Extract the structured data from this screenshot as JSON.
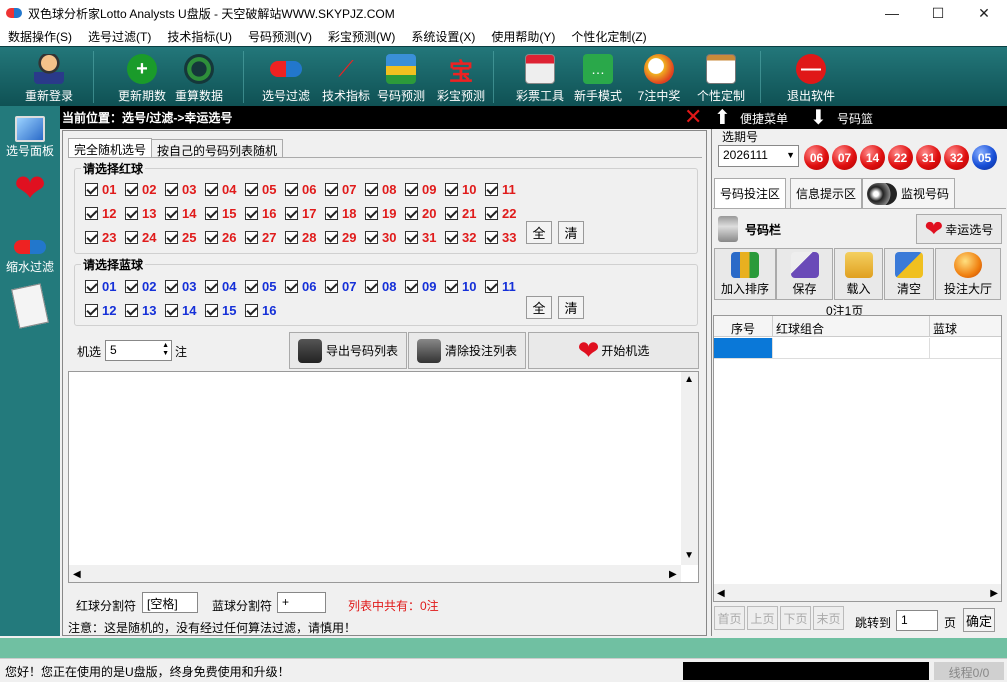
{
  "window": {
    "title": "双色球分析家Lotto Analysts U盘版 - 天空破解站WWW.SKYPJZ.COM",
    "min": "—",
    "max": "☐",
    "close": "✕"
  },
  "menu": [
    "数据操作(S)",
    "选号过滤(T)",
    "技术指标(U)",
    "号码预测(V)",
    "彩宝预测(W)",
    "系统设置(X)",
    "使用帮助(Y)",
    "个性化定制(Z)"
  ],
  "toolbar": {
    "relogin": "重新登录",
    "update": "更新期数",
    "recalc": "重算数据",
    "filter": "选号过滤",
    "tech": "技术指标",
    "predict": "号码预测",
    "cbpredict": "彩宝预测",
    "tools": "彩票工具",
    "novice": "新手模式",
    "win": "7注中奖",
    "custom": "个性定制",
    "exit": "退出软件"
  },
  "left_panel": {
    "select_panel": "选号面板",
    "shrink_filter": "缩水过滤"
  },
  "breadcrumb": {
    "text": "当前位置：选号/过滤->幸运选号",
    "quick_menu": "便捷菜单",
    "basket": "号码篮"
  },
  "tabs": {
    "random_all": "完全随机选号",
    "random_own": "按自己的号码列表随机"
  },
  "red_section": {
    "label": "请选择红球",
    "numbers": [
      "01",
      "02",
      "03",
      "04",
      "05",
      "06",
      "07",
      "08",
      "09",
      "10",
      "11",
      "12",
      "13",
      "14",
      "15",
      "16",
      "17",
      "18",
      "19",
      "20",
      "21",
      "22",
      "23",
      "24",
      "25",
      "26",
      "27",
      "28",
      "29",
      "30",
      "31",
      "32",
      "33"
    ],
    "all": "全",
    "clear": "清"
  },
  "blue_section": {
    "label": "请选择蓝球",
    "numbers": [
      "01",
      "02",
      "03",
      "04",
      "05",
      "06",
      "07",
      "08",
      "09",
      "10",
      "11",
      "12",
      "13",
      "14",
      "15",
      "16"
    ],
    "all": "全",
    "clear": "清"
  },
  "machine": {
    "label": "机选",
    "value": "5",
    "unit": "注",
    "export": "导出号码列表",
    "clear_list": "清除投注列表",
    "start": "开始机选"
  },
  "separators": {
    "red_label": "红球分割符",
    "red_value": "[空格]",
    "blue_label": "蓝球分割符",
    "blue_value": "+",
    "count_text": "列表中共有：0注"
  },
  "notice": "注意：这是随机的，没有经过任何算法过滤，请慎用！",
  "right": {
    "period_label": "选期号",
    "period_value": "2026111",
    "red_balls": [
      "06",
      "07",
      "14",
      "22",
      "31",
      "32"
    ],
    "blue_ball": "05",
    "tabs": [
      "号码投注区",
      "信息提示区",
      "监视号码"
    ],
    "basket_label": "号码栏",
    "lucky_button": "幸运选号",
    "tools": [
      "加入排序",
      "保存",
      "载入",
      "清空",
      "投注大厅"
    ],
    "page_info": "0注1页",
    "table_headers": [
      "序号",
      "红球组合",
      "蓝球"
    ],
    "pager": [
      "首页",
      "上页",
      "下页",
      "末页"
    ],
    "jump_label": "跳转到",
    "jump_value": "1",
    "page_unit": "页",
    "confirm": "确定"
  },
  "status": {
    "message": "您好！您正在使用的是U盘版，终身免费使用和升级！",
    "thread": "线程0/0"
  }
}
